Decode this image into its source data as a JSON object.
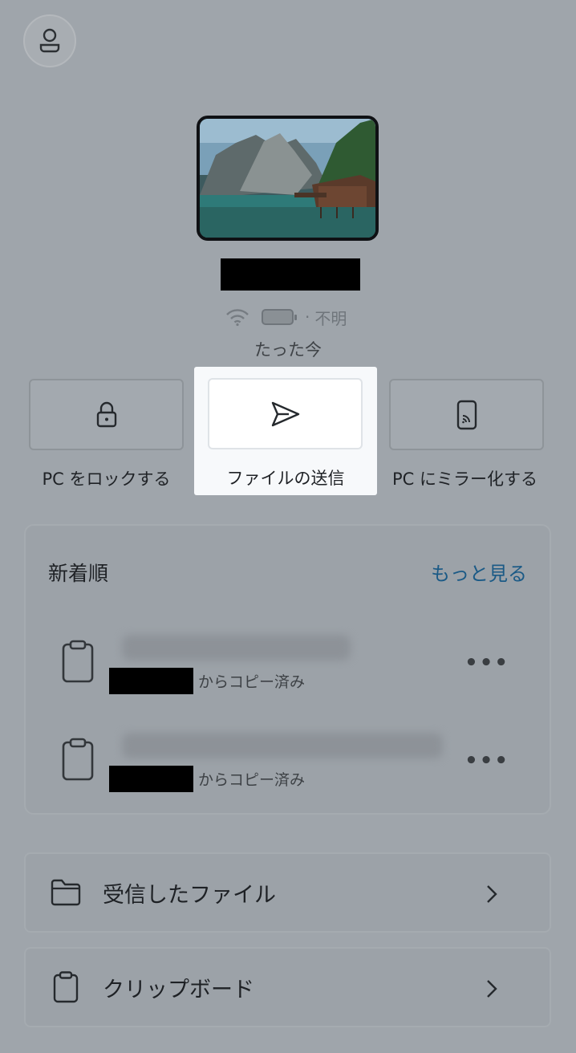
{
  "header": {
    "account_icon": "person-icon"
  },
  "device": {
    "wallpaper": "mountain-lake-boathouse",
    "name_redacted": true,
    "wifi_icon": "wifi-icon",
    "battery_icon": "battery-icon",
    "battery_separator": "·",
    "battery_status": "不明",
    "last_seen": "たった今"
  },
  "actions": [
    {
      "label": "PC をロックする",
      "icon": "lock-icon"
    },
    {
      "label": "ファイルの送信",
      "icon": "send-icon"
    },
    {
      "label": "PC にミラー化する",
      "icon": "phone-cast-icon"
    }
  ],
  "recent": {
    "title": "新着順",
    "more_link": "もっと見る",
    "items": [
      {
        "icon": "clipboard-icon",
        "text_blurred": true,
        "source_suffix": "からコピー済み",
        "menu": "•••"
      },
      {
        "icon": "clipboard-icon",
        "text_blurred": true,
        "source_suffix": "からコピー済み",
        "menu": "•••"
      }
    ]
  },
  "nav": [
    {
      "label": "受信したファイル",
      "icon": "folder-icon",
      "chevron": "chevron-right-icon"
    },
    {
      "label": "クリップボード",
      "icon": "clipboard-icon",
      "chevron": "chevron-right-icon"
    }
  ],
  "colors": {
    "overlay_background": "#9fa5ab",
    "highlight": "#f7f9fb",
    "link": "#1b5a86"
  }
}
